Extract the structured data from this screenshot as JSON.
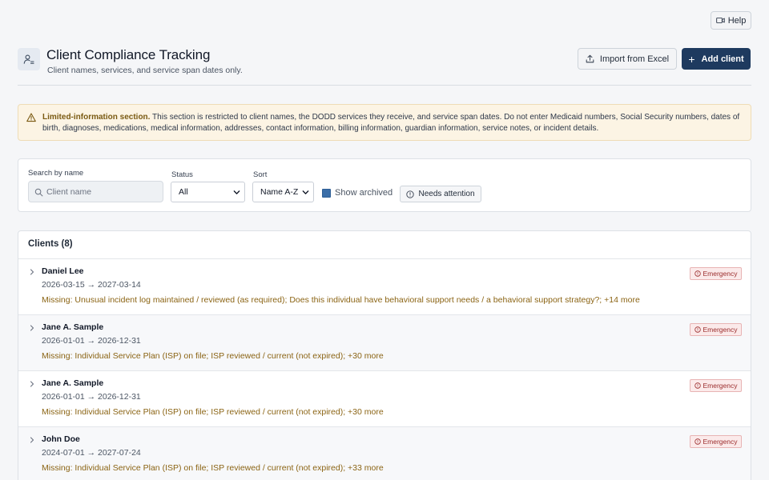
{
  "help_label": "Help",
  "header": {
    "title": "Client Compliance Tracking",
    "subtitle": "Client names, services, and service span dates only.",
    "import_label": "Import from Excel",
    "add_label": "Add client",
    "icons": {
      "header": "user-list-icon",
      "import": "upload-icon",
      "add": "plus-icon",
      "help": "video-icon"
    }
  },
  "alert": {
    "title": "Limited-information section.",
    "body": " This section is restricted to client names, the DODD services they receive, and service span dates. Do not enter Medicaid numbers, Social Security numbers, dates of birth, diagnoses, medications, medical information, addresses, contact information, billing information, guardian information, service notes, or incident details.",
    "icon": "warning-icon"
  },
  "filters": {
    "search_label": "Search by name",
    "search_placeholder": "Client name",
    "search_value": "",
    "status_label": "Status",
    "status_value": "All",
    "sort_label": "Sort",
    "sort_value": "Name A-Z",
    "archived_label": "Show archived",
    "archived_checked": true,
    "needs_attention_label": "Needs attention"
  },
  "clients": {
    "title": "Clients (8)",
    "rows": [
      {
        "name": "Daniel Lee",
        "dates": "2026-03-15 → 2027-03-14",
        "missing": "Missing: Unusual incident log maintained / reviewed (as required); Does this individual have behavioral support needs / a behavioral support strategy?; +14 more",
        "badge": "Emergency"
      },
      {
        "name": "Jane A. Sample",
        "dates": "2026-01-01 → 2026-12-31",
        "missing": "Missing: Individual Service Plan (ISP) on file; ISP reviewed / current (not expired); +30 more",
        "badge": "Emergency"
      },
      {
        "name": "Jane A. Sample",
        "dates": "2026-01-01 → 2026-12-31",
        "missing": "Missing: Individual Service Plan (ISP) on file; ISP reviewed / current (not expired); +30 more",
        "badge": "Emergency"
      },
      {
        "name": "John Doe",
        "dates": "2024-07-01 → 2027-07-24",
        "missing": "Missing: Individual Service Plan (ISP) on file; ISP reviewed / current (not expired); +33 more",
        "badge": "Emergency"
      }
    ]
  },
  "colors": {
    "primary": "#1e3a5f",
    "warning_bg": "#fcf4e4",
    "missing_text": "#8b6414",
    "badge_text": "#9b2c2c",
    "checkbox": "#3b6ea8"
  }
}
